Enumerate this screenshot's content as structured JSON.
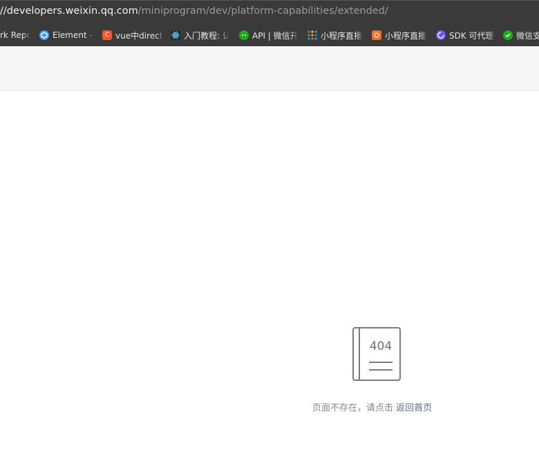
{
  "browser": {
    "url_host": "//developers.weixin.qq.com",
    "url_path": "/miniprogram/dev/platform-capabilities/extended/"
  },
  "bookmarks": [
    {
      "label": "rk Repo",
      "icon": "none"
    },
    {
      "label": "Element -",
      "icon": "element-icon",
      "color": "#409eff"
    },
    {
      "label": "vue中direct",
      "icon": "csdn-icon",
      "color": "#fc5531"
    },
    {
      "label": "入门教程: 认",
      "icon": "react-icon",
      "color": "#61dafb"
    },
    {
      "label": "API | 微信开",
      "icon": "wechat-icon",
      "color": "#1aad19"
    },
    {
      "label": "小程序直播",
      "icon": "grid-icon",
      "color": "#fa8c16"
    },
    {
      "label": "小程序直播",
      "icon": "weapp-icon",
      "color": "#f56c2d"
    },
    {
      "label": "SDK 可代理",
      "icon": "sdk-icon",
      "color": "#6a5cff"
    },
    {
      "label": "微信支",
      "icon": "wechatpay-icon",
      "color": "#1aad19"
    }
  ],
  "error": {
    "code": "404",
    "message": "页面不存在，请点击",
    "link_label": "返回首页"
  }
}
